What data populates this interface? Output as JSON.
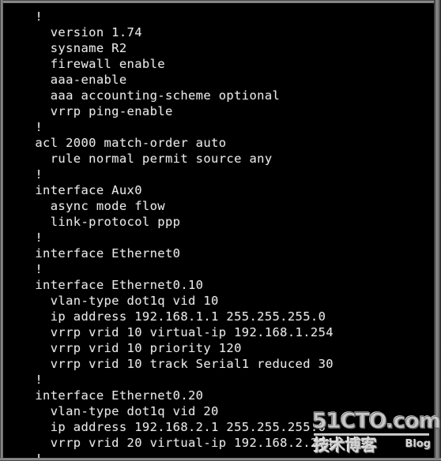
{
  "terminal": {
    "background_color": "#000000",
    "text_color": "#e6e6e6",
    "frame_color": "#8a8a8a",
    "lines": [
      "  !",
      "    version 1.74",
      "    sysname R2",
      "    firewall enable",
      "    aaa-enable",
      "    aaa accounting-scheme optional",
      "    vrrp ping-enable",
      "  !",
      "  acl 2000 match-order auto",
      "    rule normal permit source any",
      "  !",
      "  interface Aux0",
      "    async mode flow",
      "    link-protocol ppp",
      "  !",
      "  interface Ethernet0",
      "  !",
      "  interface Ethernet0.10",
      "    vlan-type dot1q vid 10",
      "    ip address 192.168.1.1 255.255.255.0",
      "    vrrp vrid 10 virtual-ip 192.168.1.254",
      "    vrrp vrid 10 priority 120",
      "    vrrp vrid 10 track Serial1 reduced 30",
      "  !",
      "  interface Ethernet0.20",
      "    vlan-type dot1q vid 20",
      "    ip address 192.168.2.1 255.255.255.0",
      "    vrrp vrid 20 virtual-ip 192.168.2.254",
      "  !"
    ]
  },
  "watermark": {
    "brand": "51CTO.com",
    "chinese": "技术博客",
    "blog": "Blog"
  }
}
